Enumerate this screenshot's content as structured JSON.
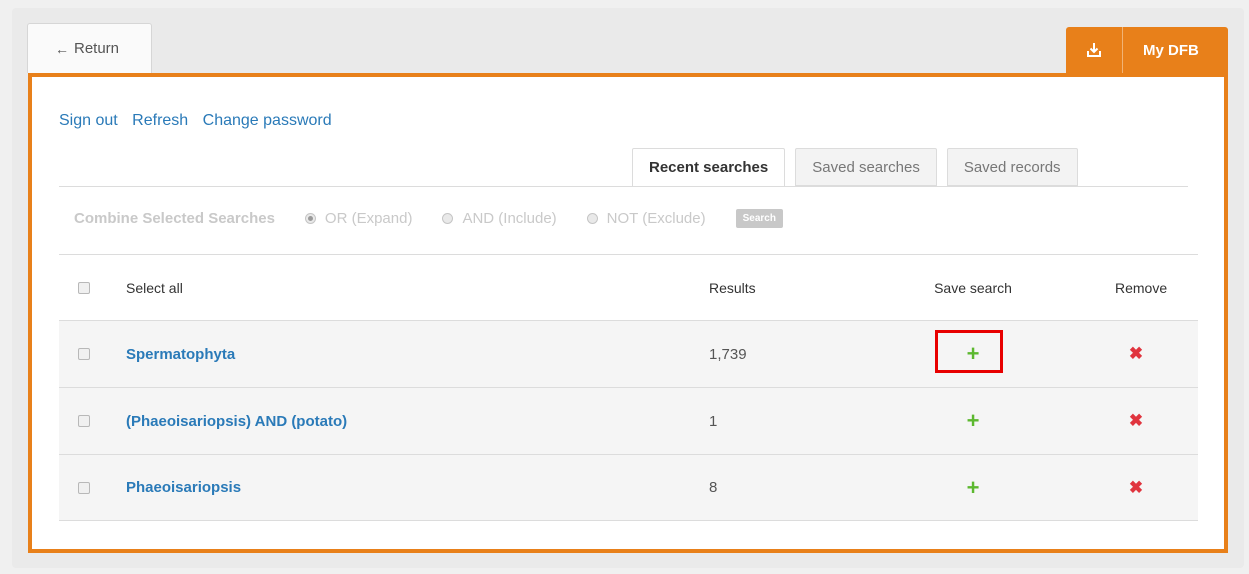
{
  "nav": {
    "return_label": "Return",
    "return_arrow": "←",
    "mydfb_label": "My DFB",
    "mydfb_icon": "download-icon"
  },
  "links": {
    "sign_out": "Sign out",
    "refresh": "Refresh",
    "change_password": "Change password"
  },
  "tabs": [
    {
      "label": "Recent searches",
      "active": true
    },
    {
      "label": "Saved searches",
      "active": false
    },
    {
      "label": "Saved records",
      "active": false
    }
  ],
  "combine": {
    "label": "Combine Selected Searches",
    "options": [
      {
        "label": "OR (Expand)",
        "selected": true
      },
      {
        "label": "AND (Include)",
        "selected": false
      },
      {
        "label": "NOT (Exclude)",
        "selected": false
      }
    ],
    "search_button": "Search"
  },
  "table": {
    "headers": {
      "select_all": "Select all",
      "results": "Results",
      "save_search": "Save search",
      "remove": "Remove"
    },
    "rows": [
      {
        "query": "Spermatophyta",
        "results": "1,739"
      },
      {
        "query": "(Phaeoisariopsis) AND (potato)",
        "results": "1"
      },
      {
        "query": "Phaeoisariopsis",
        "results": "8"
      }
    ],
    "plus_symbol": "+",
    "remove_symbol": "✖"
  },
  "colors": {
    "accent": "#e8801a",
    "link": "#2a7ab8",
    "add": "#5cb82f",
    "remove": "#e0343e",
    "highlight": "#e80000"
  }
}
